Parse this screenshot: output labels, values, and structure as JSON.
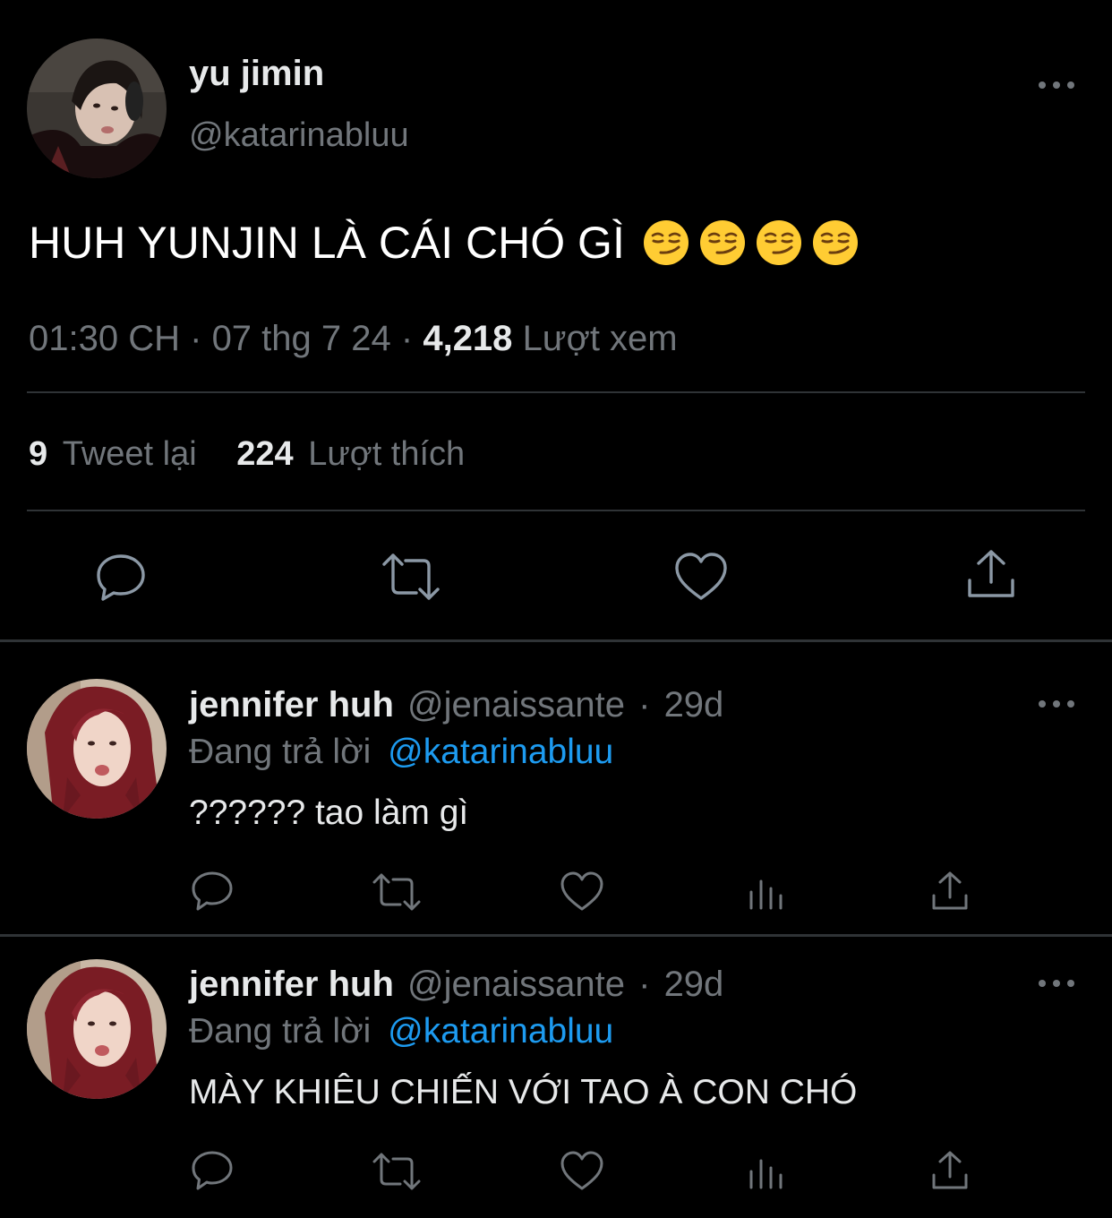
{
  "main_tweet": {
    "display_name": "yu jimin",
    "handle": "@katarinabluu",
    "text": "HUH YUNJIN LÀ CÁI CHÓ GÌ",
    "emojis": [
      "smirking-face",
      "smirking-face",
      "smirking-face",
      "smirking-face"
    ],
    "time": "01:30 CH",
    "sep": "·",
    "date": "07 thg 7 24",
    "views_count": "4,218",
    "views_label": "Lượt xem",
    "retweets_count": "9",
    "retweets_label": "Tweet lại",
    "likes_count": "224",
    "likes_label": "Lượt thích"
  },
  "replies": [
    {
      "display_name": "jennifer huh",
      "handle": "@jenaissante",
      "sep": "·",
      "age": "29d",
      "replying_label": "Đang trả lời",
      "replying_to": "@katarinabluu",
      "text": "?????? tao làm gì"
    },
    {
      "display_name": "jennifer huh",
      "handle": "@jenaissante",
      "sep": "·",
      "age": "29d",
      "replying_label": "Đang trả lời",
      "replying_to": "@katarinabluu",
      "text": "MÀY KHIÊU CHIẾN VỚI TAO À CON CHÓ"
    }
  ],
  "colors": {
    "background": "#000000",
    "primary_text": "#e7e9ea",
    "secondary_text": "#71767b",
    "mention": "#1d9bf0",
    "separator": "#2f3336"
  }
}
